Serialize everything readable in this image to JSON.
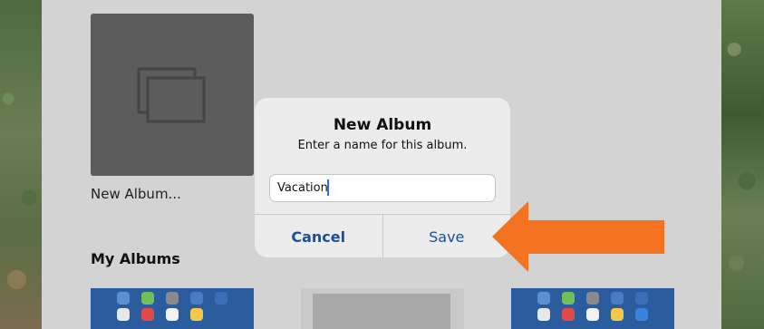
{
  "albums_page": {
    "new_album_tile_label": "New Album...",
    "section_title": "My Albums"
  },
  "dialog": {
    "title": "New Album",
    "message": "Enter a name for this album.",
    "name_field_value": "Vacation",
    "cancel_label": "Cancel",
    "save_label": "Save"
  },
  "colors": {
    "dialog_button_text": "#1a4fa0",
    "annotation_arrow": "#f47321"
  },
  "icons": [
    "album-stack-icon",
    "annotation-arrow-icon"
  ]
}
